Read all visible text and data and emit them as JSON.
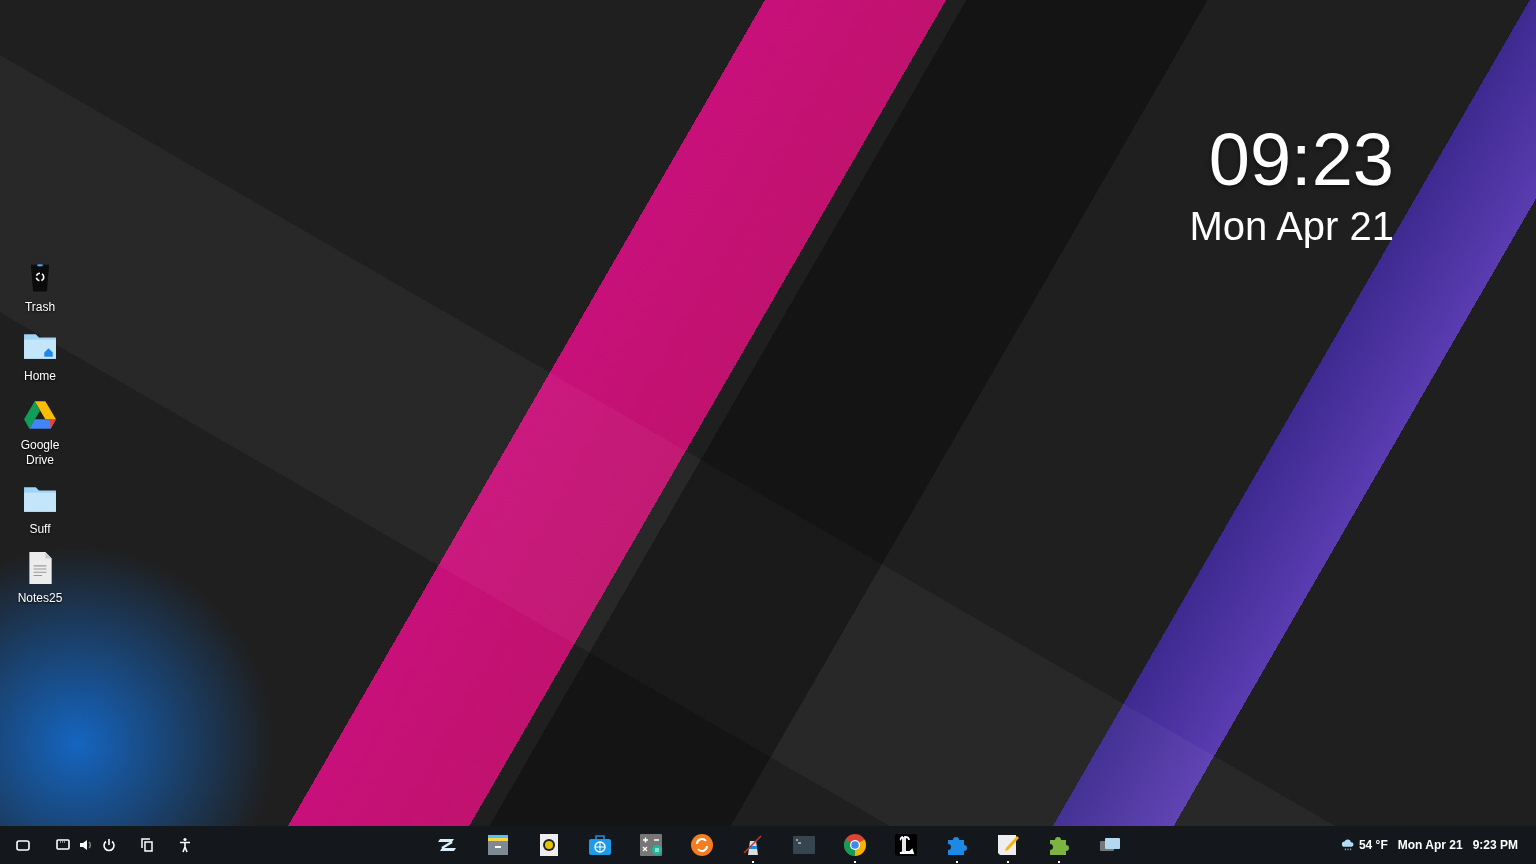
{
  "desktop_clock": {
    "time": "09:23",
    "date": "Mon Apr 21"
  },
  "desktop_icons": [
    {
      "label": "Trash",
      "kind": "trash"
    },
    {
      "label": "Home",
      "kind": "home-folder"
    },
    {
      "label": "Google Drive",
      "kind": "drive"
    },
    {
      "label": "Suff",
      "kind": "folder"
    },
    {
      "label": "Notes25",
      "kind": "document"
    }
  ],
  "taskbar": {
    "left_buttons": [
      {
        "kind": "window"
      },
      {
        "kind": "network"
      },
      {
        "kind": "volume"
      },
      {
        "kind": "power"
      },
      {
        "kind": "copy"
      },
      {
        "kind": "accessibility"
      }
    ],
    "apps": [
      {
        "kind": "zorin",
        "running": false
      },
      {
        "kind": "files",
        "running": false
      },
      {
        "kind": "player",
        "running": false
      },
      {
        "kind": "store",
        "running": false
      },
      {
        "kind": "calculator",
        "running": false
      },
      {
        "kind": "update",
        "running": false
      },
      {
        "kind": "lighthouse",
        "running": true
      },
      {
        "kind": "terminal",
        "running": false
      },
      {
        "kind": "chrome",
        "running": true
      },
      {
        "kind": "letter",
        "running": false
      },
      {
        "kind": "puzzle-blue",
        "running": true
      },
      {
        "kind": "notes",
        "running": true
      },
      {
        "kind": "puzzle-green",
        "running": true
      },
      {
        "kind": "windows",
        "running": false
      }
    ],
    "weather": {
      "temperature": "54 °F"
    },
    "date": "Mon Apr 21",
    "time": "9:23 PM"
  }
}
